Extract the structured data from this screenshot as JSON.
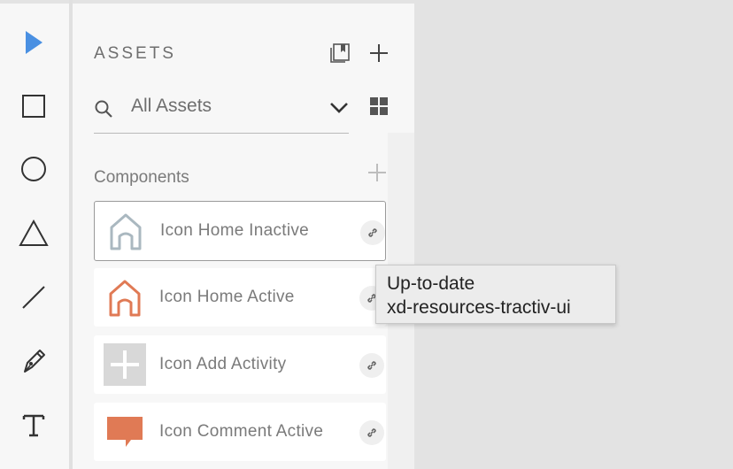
{
  "panel": {
    "title": "ASSETS",
    "search_value": "All Assets"
  },
  "components": {
    "section_label": "Components",
    "items": [
      {
        "label": "Icon Home Inactive",
        "icon": "home-outline-icon",
        "color": "#aab8c0"
      },
      {
        "label": "Icon Home Active",
        "icon": "home-outline-icon",
        "color": "#e07a55"
      },
      {
        "label": "Icon Add Activity",
        "icon": "plus-icon",
        "color": "#d8d8d8"
      },
      {
        "label": "Icon Comment Active",
        "icon": "speech-bubble-icon",
        "color": "#e07a55"
      }
    ]
  },
  "tooltip": {
    "line1": "Up-to-date",
    "line2": "xd-resources-tractiv-ui"
  },
  "colors": {
    "accent": "#4a90e2",
    "brand_orange": "#e07a55"
  }
}
